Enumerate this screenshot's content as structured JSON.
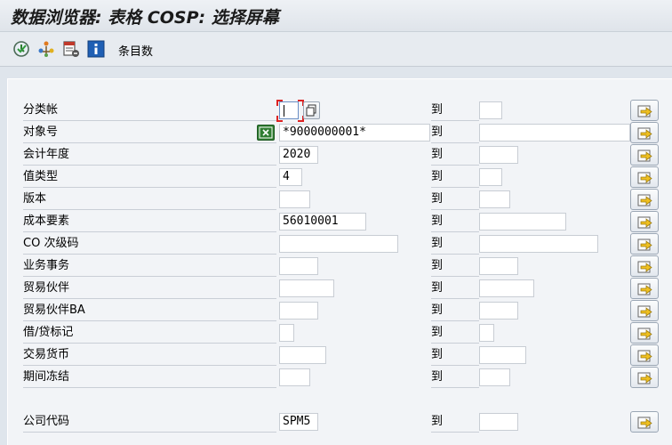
{
  "window": {
    "title": "数据浏览器: 表格 COSP: 选择屏幕"
  },
  "toolbar": {
    "icons": [
      "execute-clock-icon",
      "get-variant-icon",
      "selection-options-icon",
      "info-icon"
    ],
    "count_label": "条目数"
  },
  "to_label": "到",
  "fields": [
    {
      "label": "分类帐",
      "low": "",
      "high": ""
    },
    {
      "label": "对象号",
      "low": "*9000000001*",
      "high": ""
    },
    {
      "label": "会计年度",
      "low": "2020",
      "high": ""
    },
    {
      "label": "值类型",
      "low": "4",
      "high": ""
    },
    {
      "label": "版本",
      "low": "",
      "high": ""
    },
    {
      "label": "成本要素",
      "low": "56010001",
      "high": ""
    },
    {
      "label": "CO 次级码",
      "low": "",
      "high": ""
    },
    {
      "label": "业务事务",
      "low": "",
      "high": ""
    },
    {
      "label": "贸易伙伴",
      "low": "",
      "high": ""
    },
    {
      "label": "贸易伙伴BA",
      "low": "",
      "high": ""
    },
    {
      "label": "借/贷标记",
      "low": "",
      "high": ""
    },
    {
      "label": "交易货币",
      "low": "",
      "high": ""
    },
    {
      "label": "期间冻结",
      "low": "",
      "high": ""
    },
    {
      "label": "公司代码",
      "low": "SPM5",
      "high": ""
    }
  ],
  "colors": {
    "background": "#dfe5ec",
    "panel": "#f2f4f7",
    "arrow": "#f0c020",
    "focus": "#d22222"
  }
}
